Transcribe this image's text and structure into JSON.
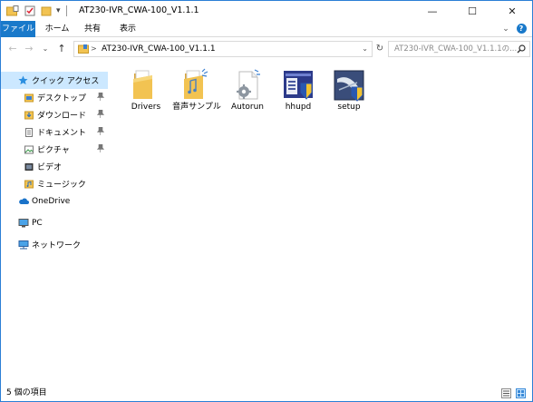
{
  "window": {
    "title": "AT230-IVR_CWA-100_V1.1.1",
    "controls": {
      "minimize": "—",
      "maximize": "☐",
      "close": "✕"
    }
  },
  "quick_access_toolbar": {
    "dropdown": "▾"
  },
  "ribbon": {
    "tabs": [
      {
        "label": "ファイル",
        "active": true
      },
      {
        "label": "ホーム"
      },
      {
        "label": "共有"
      },
      {
        "label": "表示"
      }
    ],
    "expand": "⌄",
    "help": "?"
  },
  "address_bar": {
    "back": "←",
    "forward": "→",
    "recent": "⌄",
    "up": "↑",
    "path_separator": ">",
    "path": "AT230-IVR_CWA-100_V1.1.1",
    "dropdown": "⌄",
    "refresh": "↻"
  },
  "search": {
    "placeholder": "AT230-IVR_CWA-100_V1.1.1の..."
  },
  "nav_pane": {
    "quick_access": "クイック アクセス",
    "pinned": [
      {
        "label": "デスクトップ"
      },
      {
        "label": "ダウンロード"
      },
      {
        "label": "ドキュメント"
      },
      {
        "label": "ピクチャ"
      }
    ],
    "folders": [
      {
        "label": "ビデオ"
      },
      {
        "label": "ミュージック"
      }
    ],
    "onedrive": "OneDrive",
    "pc": "PC",
    "network": "ネットワーク"
  },
  "files": [
    {
      "name": "Drivers",
      "icon": "folder-icon"
    },
    {
      "name": "音声サンプル",
      "icon": "folder-icon"
    },
    {
      "name": "Autorun",
      "icon": "autorun-file-icon"
    },
    {
      "name": "hhupd",
      "icon": "installer-icon"
    },
    {
      "name": "setup",
      "icon": "setup-icon"
    }
  ],
  "status_bar": {
    "item_count": "5 個の項目"
  },
  "colors": {
    "accent": "#1979ca",
    "selection": "#cce8ff",
    "folder": "#f2c352"
  }
}
